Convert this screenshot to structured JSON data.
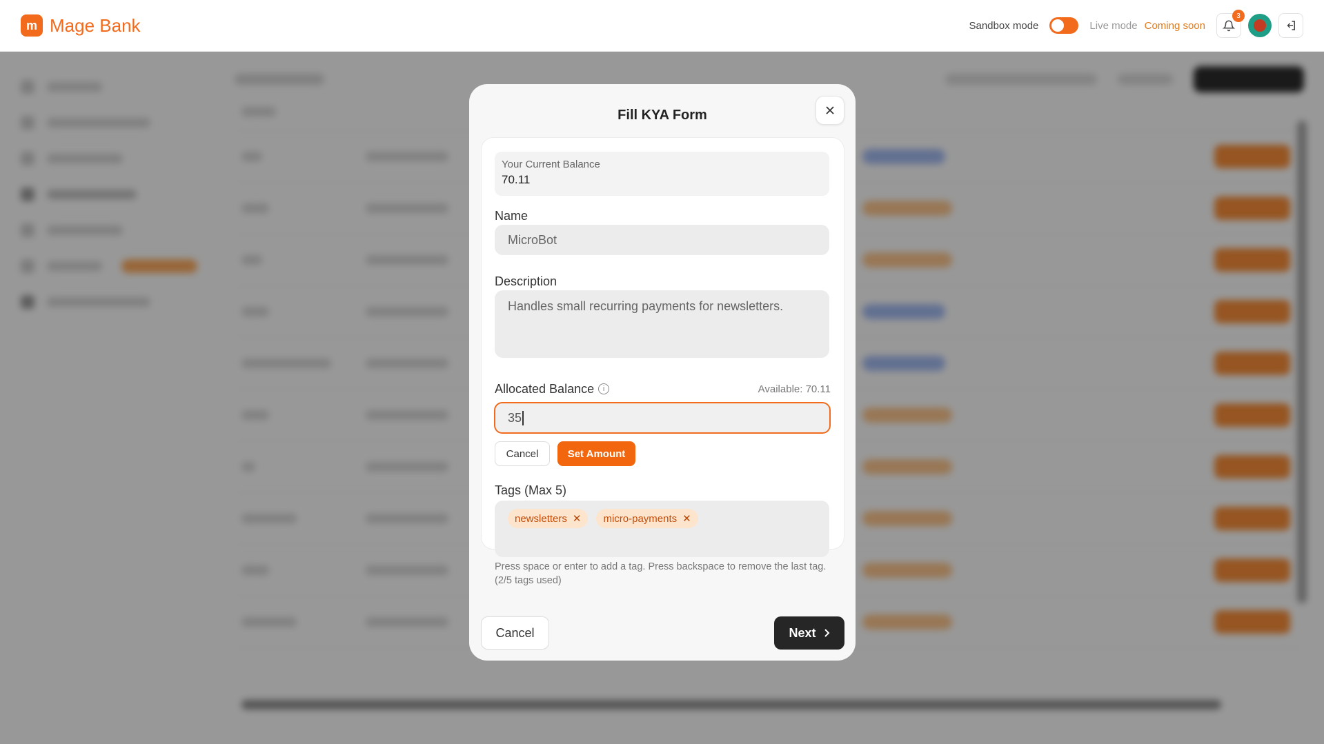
{
  "header": {
    "brand": "Mage Bank",
    "logo_glyph": "m",
    "sandbox_label": "Sandbox mode",
    "live_label": "Live mode",
    "coming_soon": "Coming soon",
    "notification_count": "3",
    "accent": "#f26b1d"
  },
  "modal": {
    "title": "Fill KYA Form",
    "current_balance_label": "Your Current Balance",
    "current_balance_value": "70.11",
    "name_label": "Name",
    "name_value": "MicroBot",
    "description_label": "Description",
    "description_value": "Handles small recurring payments for newsletters.",
    "allocated_label": "Allocated Balance",
    "available_text": "Available: 70.11",
    "amount_value": "35",
    "amount_cancel": "Cancel",
    "set_amount": "Set Amount",
    "tags_label": "Tags (Max 5)",
    "tags": [
      {
        "label": "newsletters"
      },
      {
        "label": "micro-payments"
      }
    ],
    "tags_hint": "Press space or enter to add a tag. Press backspace to remove the last tag. (2/5 tags used)",
    "cancel_label": "Cancel",
    "next_label": "Next"
  },
  "icons": {
    "close": "close-icon",
    "info": "info-icon",
    "bell": "bell-icon",
    "logout": "logout-icon",
    "chevron": "chevron-right-icon"
  }
}
